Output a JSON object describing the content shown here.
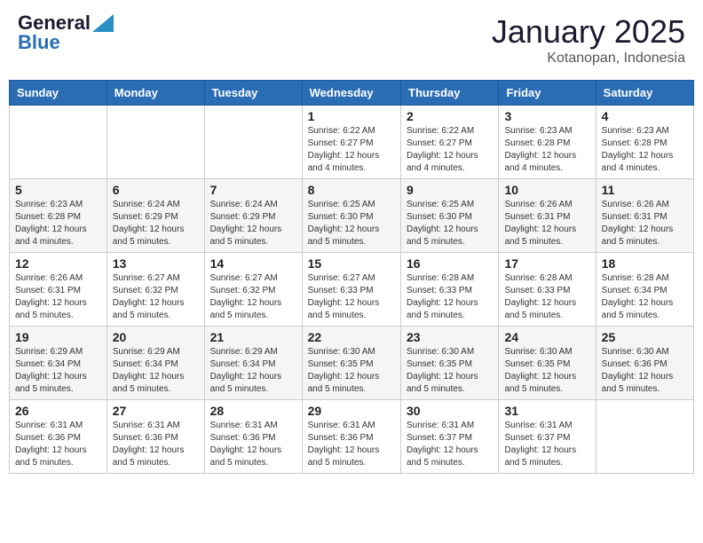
{
  "header": {
    "logo_general": "General",
    "logo_blue": "Blue",
    "month_title": "January 2025",
    "location": "Kotanopan, Indonesia"
  },
  "weekdays": [
    "Sunday",
    "Monday",
    "Tuesday",
    "Wednesday",
    "Thursday",
    "Friday",
    "Saturday"
  ],
  "weeks": [
    [
      {
        "day": "",
        "info": ""
      },
      {
        "day": "",
        "info": ""
      },
      {
        "day": "",
        "info": ""
      },
      {
        "day": "1",
        "info": "Sunrise: 6:22 AM\nSunset: 6:27 PM\nDaylight: 12 hours\nand 4 minutes."
      },
      {
        "day": "2",
        "info": "Sunrise: 6:22 AM\nSunset: 6:27 PM\nDaylight: 12 hours\nand 4 minutes."
      },
      {
        "day": "3",
        "info": "Sunrise: 6:23 AM\nSunset: 6:28 PM\nDaylight: 12 hours\nand 4 minutes."
      },
      {
        "day": "4",
        "info": "Sunrise: 6:23 AM\nSunset: 6:28 PM\nDaylight: 12 hours\nand 4 minutes."
      }
    ],
    [
      {
        "day": "5",
        "info": "Sunrise: 6:23 AM\nSunset: 6:28 PM\nDaylight: 12 hours\nand 4 minutes."
      },
      {
        "day": "6",
        "info": "Sunrise: 6:24 AM\nSunset: 6:29 PM\nDaylight: 12 hours\nand 5 minutes."
      },
      {
        "day": "7",
        "info": "Sunrise: 6:24 AM\nSunset: 6:29 PM\nDaylight: 12 hours\nand 5 minutes."
      },
      {
        "day": "8",
        "info": "Sunrise: 6:25 AM\nSunset: 6:30 PM\nDaylight: 12 hours\nand 5 minutes."
      },
      {
        "day": "9",
        "info": "Sunrise: 6:25 AM\nSunset: 6:30 PM\nDaylight: 12 hours\nand 5 minutes."
      },
      {
        "day": "10",
        "info": "Sunrise: 6:26 AM\nSunset: 6:31 PM\nDaylight: 12 hours\nand 5 minutes."
      },
      {
        "day": "11",
        "info": "Sunrise: 6:26 AM\nSunset: 6:31 PM\nDaylight: 12 hours\nand 5 minutes."
      }
    ],
    [
      {
        "day": "12",
        "info": "Sunrise: 6:26 AM\nSunset: 6:31 PM\nDaylight: 12 hours\nand 5 minutes."
      },
      {
        "day": "13",
        "info": "Sunrise: 6:27 AM\nSunset: 6:32 PM\nDaylight: 12 hours\nand 5 minutes."
      },
      {
        "day": "14",
        "info": "Sunrise: 6:27 AM\nSunset: 6:32 PM\nDaylight: 12 hours\nand 5 minutes."
      },
      {
        "day": "15",
        "info": "Sunrise: 6:27 AM\nSunset: 6:33 PM\nDaylight: 12 hours\nand 5 minutes."
      },
      {
        "day": "16",
        "info": "Sunrise: 6:28 AM\nSunset: 6:33 PM\nDaylight: 12 hours\nand 5 minutes."
      },
      {
        "day": "17",
        "info": "Sunrise: 6:28 AM\nSunset: 6:33 PM\nDaylight: 12 hours\nand 5 minutes."
      },
      {
        "day": "18",
        "info": "Sunrise: 6:28 AM\nSunset: 6:34 PM\nDaylight: 12 hours\nand 5 minutes."
      }
    ],
    [
      {
        "day": "19",
        "info": "Sunrise: 6:29 AM\nSunset: 6:34 PM\nDaylight: 12 hours\nand 5 minutes."
      },
      {
        "day": "20",
        "info": "Sunrise: 6:29 AM\nSunset: 6:34 PM\nDaylight: 12 hours\nand 5 minutes."
      },
      {
        "day": "21",
        "info": "Sunrise: 6:29 AM\nSunset: 6:34 PM\nDaylight: 12 hours\nand 5 minutes."
      },
      {
        "day": "22",
        "info": "Sunrise: 6:30 AM\nSunset: 6:35 PM\nDaylight: 12 hours\nand 5 minutes."
      },
      {
        "day": "23",
        "info": "Sunrise: 6:30 AM\nSunset: 6:35 PM\nDaylight: 12 hours\nand 5 minutes."
      },
      {
        "day": "24",
        "info": "Sunrise: 6:30 AM\nSunset: 6:35 PM\nDaylight: 12 hours\nand 5 minutes."
      },
      {
        "day": "25",
        "info": "Sunrise: 6:30 AM\nSunset: 6:36 PM\nDaylight: 12 hours\nand 5 minutes."
      }
    ],
    [
      {
        "day": "26",
        "info": "Sunrise: 6:31 AM\nSunset: 6:36 PM\nDaylight: 12 hours\nand 5 minutes."
      },
      {
        "day": "27",
        "info": "Sunrise: 6:31 AM\nSunset: 6:36 PM\nDaylight: 12 hours\nand 5 minutes."
      },
      {
        "day": "28",
        "info": "Sunrise: 6:31 AM\nSunset: 6:36 PM\nDaylight: 12 hours\nand 5 minutes."
      },
      {
        "day": "29",
        "info": "Sunrise: 6:31 AM\nSunset: 6:36 PM\nDaylight: 12 hours\nand 5 minutes."
      },
      {
        "day": "30",
        "info": "Sunrise: 6:31 AM\nSunset: 6:37 PM\nDaylight: 12 hours\nand 5 minutes."
      },
      {
        "day": "31",
        "info": "Sunrise: 6:31 AM\nSunset: 6:37 PM\nDaylight: 12 hours\nand 5 minutes."
      },
      {
        "day": "",
        "info": ""
      }
    ]
  ]
}
